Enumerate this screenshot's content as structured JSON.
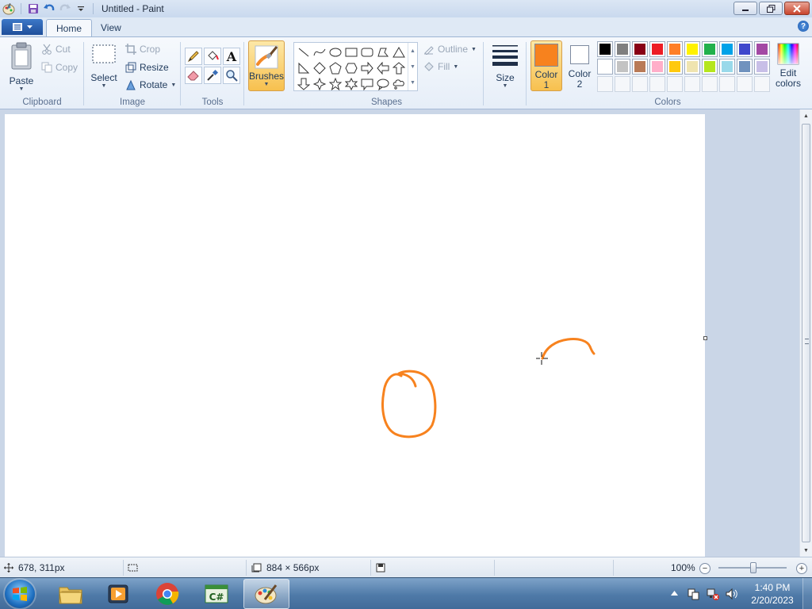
{
  "window": {
    "title": "Untitled - Paint"
  },
  "ribbon_tabs": {
    "home": "Home",
    "view": "View"
  },
  "clipboard": {
    "paste": "Paste",
    "cut": "Cut",
    "copy": "Copy",
    "group_label": "Clipboard"
  },
  "image": {
    "select": "Select",
    "crop": "Crop",
    "resize": "Resize",
    "rotate": "Rotate",
    "group_label": "Image"
  },
  "tools": {
    "group_label": "Tools",
    "text_tool_glyph": "A"
  },
  "brushes": {
    "label": "Brushes"
  },
  "shapes": {
    "outline": "Outline",
    "fill": "Fill",
    "group_label": "Shapes"
  },
  "size": {
    "label": "Size"
  },
  "colors": {
    "color1_label_line1": "Color",
    "color1_label_line2": "1",
    "color2_label_line1": "Color",
    "color2_label_line2": "2",
    "color1_value": "#f7821e",
    "color2_value": "#ffffff",
    "edit_colors_line1": "Edit",
    "edit_colors_line2": "colors",
    "group_label": "Colors",
    "palette_row1": [
      "#000000",
      "#7f7f7f",
      "#880015",
      "#ed1c24",
      "#ff7f27",
      "#fff200",
      "#22b14c",
      "#00a2e8",
      "#3f48cc",
      "#a349a4"
    ],
    "palette_row2": [
      "#ffffff",
      "#c3c3c3",
      "#b97a57",
      "#ffaec9",
      "#ffc90e",
      "#efe4b0",
      "#b5e61d",
      "#99d9ea",
      "#7092be",
      "#c8bfe7"
    ]
  },
  "status": {
    "cursor_position": "678, 311px",
    "canvas_size": "884 × 566px",
    "zoom": "100%"
  },
  "taskbar": {
    "time": "1:40 PM",
    "date": "2/20/2023"
  }
}
